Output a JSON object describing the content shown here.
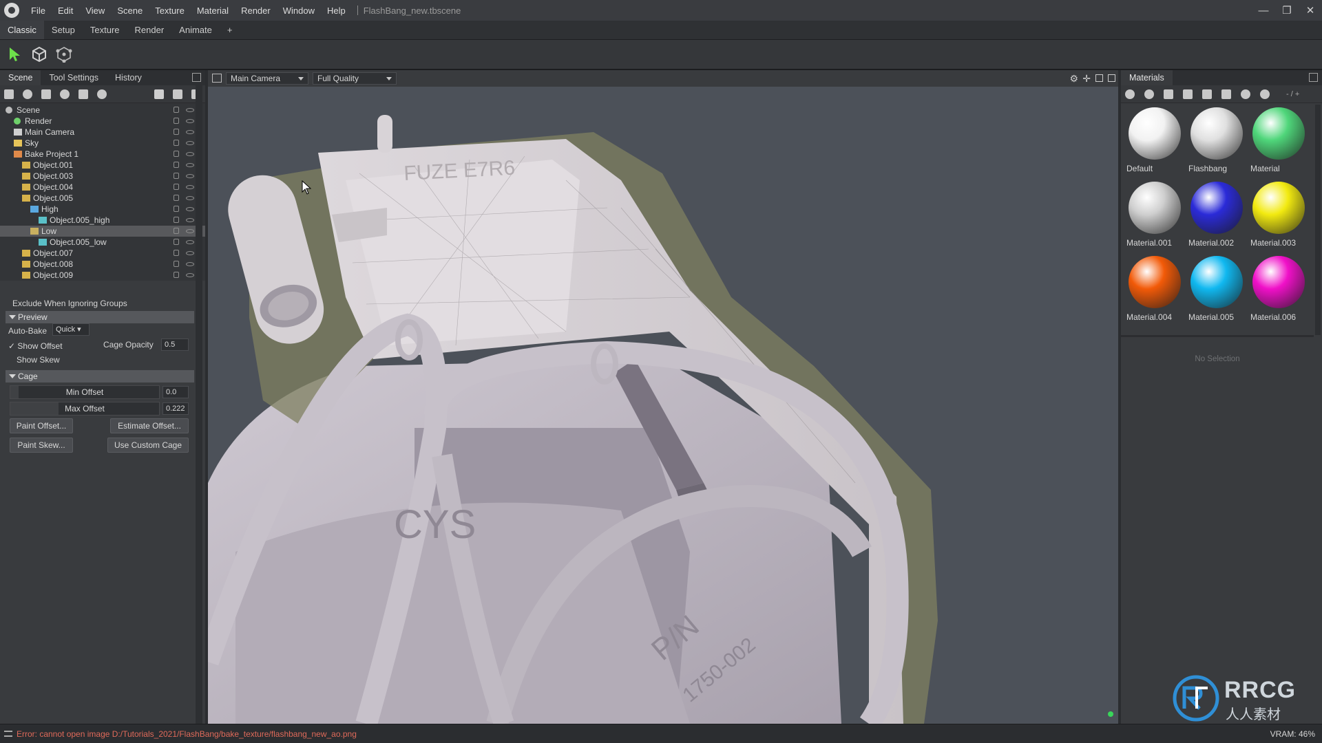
{
  "window": {
    "menu": [
      "File",
      "Edit",
      "View",
      "Scene",
      "Texture",
      "Material",
      "Render",
      "Window",
      "Help"
    ],
    "doc_title": "FlashBang_new.tbscene",
    "controls": {
      "minimize": "—",
      "maximize": "❐",
      "close": "✕"
    }
  },
  "workspace_tabs": [
    "Classic",
    "Setup",
    "Texture",
    "Render",
    "Animate",
    "+"
  ],
  "left_panel": {
    "tabs": [
      "Scene",
      "Tool Settings",
      "History"
    ],
    "tree": [
      {
        "label": "Scene",
        "depth": 0,
        "icon": "scene-icon"
      },
      {
        "label": "Render",
        "depth": 1,
        "icon": "render-icon"
      },
      {
        "label": "Main Camera",
        "depth": 1,
        "icon": "camera-icon"
      },
      {
        "label": "Sky",
        "depth": 1,
        "icon": "sky-icon"
      },
      {
        "label": "Bake Project 1",
        "depth": 1,
        "icon": "bake-icon"
      },
      {
        "label": "Object.001",
        "depth": 2,
        "icon": "folder-icon"
      },
      {
        "label": "Object.003",
        "depth": 2,
        "icon": "folder-icon"
      },
      {
        "label": "Object.004",
        "depth": 2,
        "icon": "folder-icon"
      },
      {
        "label": "Object.005",
        "depth": 2,
        "icon": "folder-icon"
      },
      {
        "label": "High",
        "depth": 3,
        "icon": "high-group-icon"
      },
      {
        "label": "Object.005_high",
        "depth": 4,
        "icon": "mesh-icon"
      },
      {
        "label": "Low",
        "depth": 3,
        "icon": "low-group-icon",
        "selected": true
      },
      {
        "label": "Object.005_low",
        "depth": 4,
        "icon": "mesh-icon"
      },
      {
        "label": "Object.007",
        "depth": 2,
        "icon": "folder-icon"
      },
      {
        "label": "Object.008",
        "depth": 2,
        "icon": "folder-icon"
      },
      {
        "label": "Object.009",
        "depth": 2,
        "icon": "folder-icon"
      }
    ],
    "exclude_label": "Exclude When Ignoring Groups",
    "preview": {
      "header": "Preview",
      "auto_bake_label": "Auto-Bake",
      "auto_bake_value": "Quick",
      "show_offset_label": "Show Offset",
      "show_offset_checked": true,
      "cage_opacity_label": "Cage Opacity",
      "cage_opacity_value": "0.5",
      "show_skew_label": "Show Skew",
      "show_skew_checked": false
    },
    "cage": {
      "header": "Cage",
      "min_offset_label": "Min Offset",
      "min_offset_value": "0.0",
      "max_offset_label": "Max Offset",
      "max_offset_value": "0.222",
      "paint_offset": "Paint Offset...",
      "estimate_offset": "Estimate Offset...",
      "paint_skew": "Paint Skew...",
      "use_custom_cage": "Use Custom Cage"
    }
  },
  "viewport": {
    "camera": "Main Camera",
    "quality": "Full Quality",
    "model_text_top": "FUZE E7R6",
    "model_text_body": "CYS",
    "model_text_pn": "P/N",
    "model_text_num": "1750-002"
  },
  "materials_panel": {
    "title": "Materials",
    "counter": "- / +",
    "items": [
      {
        "name": "Default",
        "color": "#f2f2f2"
      },
      {
        "name": "Flashbang",
        "color": "#e0e0e0"
      },
      {
        "name": "Material",
        "color": "#4fd67a"
      },
      {
        "name": "Material.001",
        "color": "#cfcfcf"
      },
      {
        "name": "Material.002",
        "color": "#2b2bd8"
      },
      {
        "name": "Material.003",
        "color": "#f2ea10"
      },
      {
        "name": "Material.004",
        "color": "#f25a08"
      },
      {
        "name": "Material.005",
        "color": "#10b8f0"
      },
      {
        "name": "Material.006",
        "color": "#f010c8"
      }
    ],
    "no_selection": "No Selection"
  },
  "status": {
    "message": "Error: cannot open image D:/Tutorials_2021/FlashBang/bake_texture/flashbang_new_ao.png",
    "vram": "VRAM: 46%"
  },
  "watermark": {
    "brand": "RRCG",
    "sub": "人人素材"
  }
}
